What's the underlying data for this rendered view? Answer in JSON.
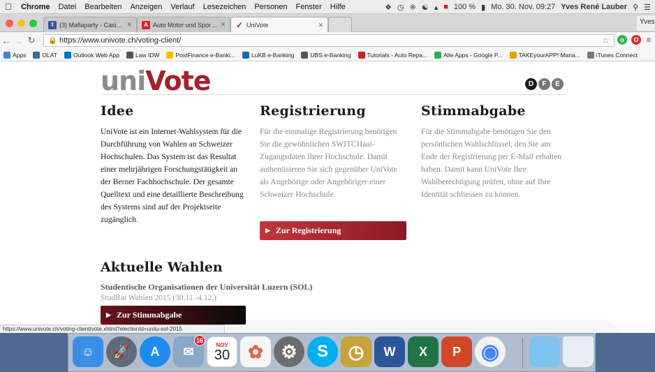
{
  "menubar": {
    "apple": "",
    "app": "Chrome",
    "items": [
      "Datei",
      "Bearbeiten",
      "Anzeigen",
      "Verlauf",
      "Lesezeichen",
      "Personen",
      "Fenster",
      "Hilfe"
    ],
    "battery": "100 %",
    "clock": "Mo. 30. Nov. 09:27",
    "user": "Yves René Lauber"
  },
  "tabs": [
    {
      "title": "(3) Mafiaparty - Casino Ro...",
      "favicon": "f",
      "color": "#3b5998"
    },
    {
      "title": "Auto Motor und Sport | Tes...",
      "favicon": "A",
      "color": "#d22"
    },
    {
      "title": "UniVote",
      "favicon": "✓",
      "color": "#a3222c"
    }
  ],
  "profile": "Yves",
  "toolbar": {
    "url": "https://www.univote.ch/voting-client/"
  },
  "bookmarks": [
    {
      "label": "Apps",
      "color": "#4a7fd4"
    },
    {
      "label": "OLAT",
      "color": "#3a6a9a"
    },
    {
      "label": "Outlook Web App",
      "color": "#0072c6"
    },
    {
      "label": "Law IDW",
      "color": "#555"
    },
    {
      "label": "PostFinance e-Banki...",
      "color": "#f2c200"
    },
    {
      "label": "LuKB e-Banking",
      "color": "#1f66b0"
    },
    {
      "label": "UBS e-Banking",
      "color": "#555"
    },
    {
      "label": "Tutorials - Auto Repa...",
      "color": "#c22"
    },
    {
      "label": "Alle Apps - Google P...",
      "color": "#34a853"
    },
    {
      "label": "TAKEyourAPP! Mana...",
      "color": "#e5a000"
    },
    {
      "label": "iTunes Connect",
      "color": "#777"
    }
  ],
  "logo": {
    "uni": "uni",
    "v": "V",
    "ote": "ote"
  },
  "languages": [
    {
      "code": "D",
      "active": true
    },
    {
      "code": "F",
      "active": false
    },
    {
      "code": "E",
      "active": false
    }
  ],
  "columns": {
    "idee": {
      "title": "Idee",
      "text": "UniVote ist ein Internet-Wahlsystem für die Durchführung von Wahlen an Schweizer Hochschulen. Das System ist das Resultat einer mehrjährigen Forschungstätigkeit an der Berner Fachhochschule. Der gesamte Quelltext und eine detaillierte Beschreibung des Systems sind auf der Projektseite zugänglich."
    },
    "registrierung": {
      "title": "Registrierung",
      "text": "Für die einmalige Registrierung benötigen Sie die gewöhnlichen SWITCHaai-Zugangsdaten Ihrer Hochschule. Damit authentisieren Sie sich gegenüber UniVote als Angehörige oder Angehöriger einer Schweizer Hochschule.",
      "button": "Zur Registrierung"
    },
    "stimmabgabe": {
      "title": "Stimmabgabe",
      "text": "Für die Stimmabgabe benötigen Sie den persönlichen Wahlschlüssel, den Sie am Ende der Registrierung per E-Mail erhalten haben. Damit kann UniVote Ihre Wahlberechtigung prüfen, ohne auf Ihre Identität schliessen zu können."
    }
  },
  "elections": {
    "title": "Aktuelle Wahlen",
    "org": "Studentische Organisationen der Universität Luzern (SOL)",
    "period": "StudRat Wahlen 2015 (30.11.-4.12.)",
    "button": "Zur Stimmabgabe"
  },
  "statusbar": "https://www.univote.ch/voting-client/vote.xhtml?electionId=unilu-sol-2015",
  "dock": [
    {
      "name": "finder",
      "glyph": "☺",
      "color": "#3a8ee6"
    },
    {
      "name": "launchpad",
      "glyph": "🚀",
      "color": "#606a78"
    },
    {
      "name": "app-store",
      "glyph": "A",
      "color": "#1d8cf0"
    },
    {
      "name": "mail",
      "glyph": "✉",
      "color": "#8aa8c8",
      "badge": "16"
    },
    {
      "name": "calendar",
      "glyph": "30",
      "color": "#ffffff"
    },
    {
      "name": "photos",
      "glyph": "✿",
      "color": "#f5f5f5"
    },
    {
      "name": "system-preferences",
      "glyph": "⚙",
      "color": "#6c6c6c"
    },
    {
      "name": "skype",
      "glyph": "S",
      "color": "#00aff0"
    },
    {
      "name": "clock-app",
      "glyph": "◷",
      "color": "#c9a23a"
    },
    {
      "name": "word",
      "glyph": "W",
      "color": "#2b579a"
    },
    {
      "name": "excel",
      "glyph": "X",
      "color": "#217346"
    },
    {
      "name": "powerpoint",
      "glyph": "P",
      "color": "#d24726"
    },
    {
      "name": "chrome",
      "glyph": "◉",
      "color": "#f2f2f2"
    },
    {
      "name": "folder",
      "glyph": "",
      "color": "#7fc3ee"
    },
    {
      "name": "trash",
      "glyph": "",
      "color": "#e8eef3"
    }
  ],
  "calendar_month": "NOV"
}
